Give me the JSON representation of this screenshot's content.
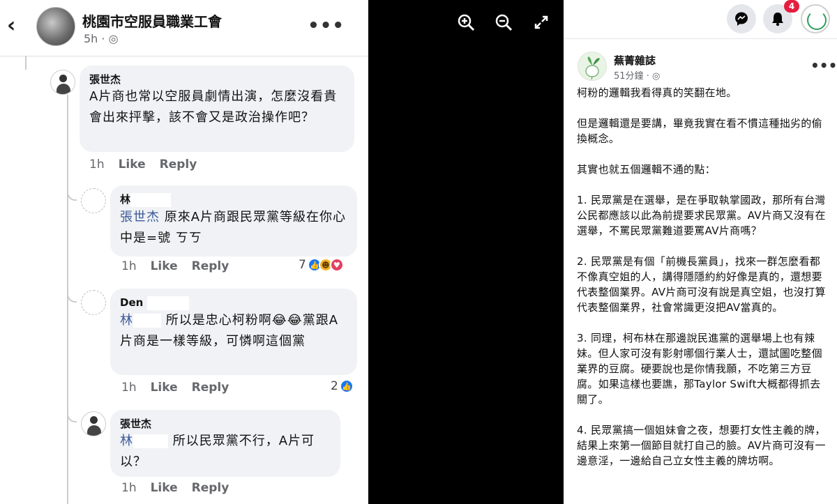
{
  "left": {
    "group_name": "桃園市空服員職業工會",
    "time": "5h",
    "comments": [
      {
        "author": "張世杰",
        "text": "A片商也常以空服員劇情出演，怎麼沒看貴會出來抨擊，該不會又是政治操作吧？",
        "time": "1h",
        "like": "Like",
        "reply": "Reply"
      },
      {
        "author": "林",
        "mention": "張世杰",
        "text": "原來A片商跟民眾黨等級在你心中是=號 ㄎㄎ",
        "time": "1h",
        "like": "Like",
        "reply": "Reply",
        "reaction_count": "7"
      },
      {
        "author": "Den",
        "mention": "林",
        "text": "所以是忠心柯粉啊😂😂黨跟A片商是一樣等級，可憐啊這個黨",
        "time": "1h",
        "like": "Like",
        "reply": "Reply",
        "reaction_count": "2"
      },
      {
        "author": "張世杰",
        "mention": "林",
        "text": "所以民眾黨不行，A片可以？",
        "time": "1h",
        "like": "Like",
        "reply": "Reply"
      }
    ]
  },
  "right": {
    "notification_count": "4",
    "page_name": "蕪菁雜誌",
    "time": "51分鐘",
    "paragraphs": [
      "柯粉的邏輯我看得真的笑翻在地。",
      "但是邏輯還是要講，畢竟我實在看不慣這種拙劣的偷換概念。",
      "其實也就五個邏輯不通的點：",
      "1. 民眾黨是在選舉，是在爭取執掌國政，那所有台灣公民都應該以此為前提要求民眾黨。AV片商又沒有在選舉，不罵民眾黨難道要罵AV片商嗎？",
      "2. 民眾黨是有個「前機長黨員」，找來一群怎麼看都不像真空姐的人，講得隱隱約約好像是真的，還想要代表整個業界。AV片商可沒有說是真空姐，也沒打算代表整個業界，社會常識更沒把AV當真的。",
      "3. 同理，柯布林在那邊說民進黨的選舉場上也有辣妹。但人家可沒有影射哪個行業人士，還試圖吃整個業界的豆腐。硬要說也是你情我願，不吃第三方豆腐。如果這樣也要譙，那Taylor Swift大概都得抓去關了。",
      "4. 民眾黨搞一個姐妹會之夜，想要打女性主義的牌，結果上來第一個節目就打自己的臉。AV片商可沒有一邊意淫，一邊給自己立女性主義的牌坊啊。"
    ]
  },
  "icons": {
    "back": "back-arrow-icon",
    "zoom_in": "zoom-in-icon",
    "zoom_out": "zoom-out-icon",
    "fullscreen": "fullscreen-icon",
    "messenger": "messenger-icon",
    "bell": "bell-icon"
  }
}
